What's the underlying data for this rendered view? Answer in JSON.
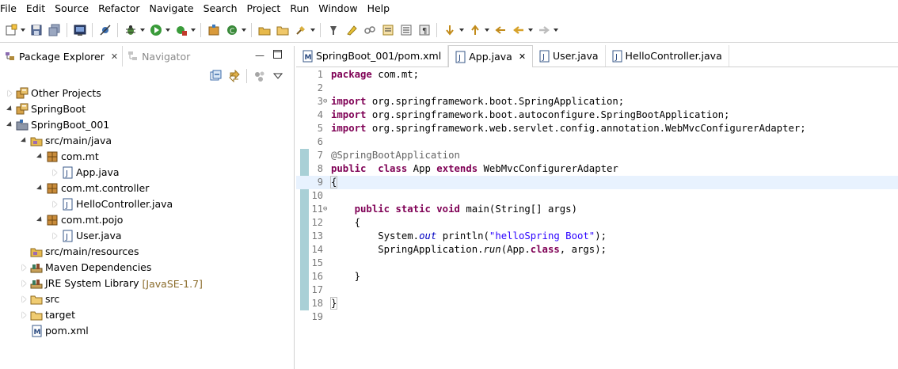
{
  "menu": [
    "File",
    "Edit",
    "Source",
    "Refactor",
    "Navigate",
    "Search",
    "Project",
    "Run",
    "Window",
    "Help"
  ],
  "left_tabs": {
    "package_explorer": "Package Explorer",
    "navigator": "Navigator"
  },
  "tree": [
    {
      "label": "Other Projects",
      "icon": "working-set-icon",
      "twisty": "closed",
      "depth": 0
    },
    {
      "label": "SpringBoot",
      "icon": "working-set-icon",
      "twisty": "open",
      "depth": 0
    },
    {
      "label": "SpringBoot_001",
      "icon": "project-icon",
      "twisty": "open",
      "depth": 1
    },
    {
      "label": "src/main/java",
      "icon": "source-folder-icon",
      "twisty": "open",
      "depth": 2
    },
    {
      "label": "com.mt",
      "icon": "package-icon",
      "twisty": "open",
      "depth": 3
    },
    {
      "label": "App.java",
      "icon": "java-file-icon",
      "twisty": "closed",
      "depth": 4
    },
    {
      "label": "com.mt.controller",
      "icon": "package-icon",
      "twisty": "open",
      "depth": 3
    },
    {
      "label": "HelloController.java",
      "icon": "java-file-icon",
      "twisty": "closed",
      "depth": 4
    },
    {
      "label": "com.mt.pojo",
      "icon": "package-icon",
      "twisty": "open",
      "depth": 3
    },
    {
      "label": "User.java",
      "icon": "java-file-icon",
      "twisty": "closed",
      "depth": 4
    },
    {
      "label": "src/main/resources",
      "icon": "source-folder-icon",
      "twisty": "none",
      "depth": 2
    },
    {
      "label": "Maven Dependencies",
      "icon": "library-icon",
      "twisty": "closed",
      "depth": 2
    },
    {
      "label": "JRE System Library",
      "icon": "library-icon",
      "twisty": "closed",
      "depth": 2,
      "deco": "[JavaSE-1.7]"
    },
    {
      "label": "src",
      "icon": "folder-icon",
      "twisty": "closed",
      "depth": 2
    },
    {
      "label": "target",
      "icon": "folder-icon",
      "twisty": "closed",
      "depth": 2
    },
    {
      "label": "pom.xml",
      "icon": "xml-file-icon",
      "twisty": "none",
      "depth": 2
    }
  ],
  "editor_tabs": [
    {
      "label": "SpringBoot_001/pom.xml",
      "icon": "maven-file-icon",
      "active": false
    },
    {
      "label": "App.java",
      "icon": "java-file-icon",
      "active": true
    },
    {
      "label": "User.java",
      "icon": "java-file-icon",
      "active": false
    },
    {
      "label": "HelloController.java",
      "icon": "java-file-icon",
      "active": false
    }
  ],
  "code": [
    {
      "n": "1",
      "tokens": [
        [
          "kw",
          "package"
        ],
        [
          "",
          "com.mt;"
        ]
      ]
    },
    {
      "n": "2",
      "tokens": []
    },
    {
      "n": "3",
      "fold": "minus",
      "tokens": [
        [
          "kw",
          "import"
        ],
        [
          "",
          "org.springframework.boot.SpringApplication;"
        ]
      ]
    },
    {
      "n": "4",
      "tokens": [
        [
          "kw",
          "import"
        ],
        [
          "",
          "org.springframework.boot.autoconfigure.SpringBootApplication;"
        ]
      ]
    },
    {
      "n": "5",
      "tokens": [
        [
          "kw",
          "import"
        ],
        [
          "",
          "org.springframework.web.servlet.config.annotation.WebMvcConfigurerAdapter;"
        ]
      ]
    },
    {
      "n": "6",
      "tokens": []
    },
    {
      "n": "7",
      "tokens": [
        [
          "ann",
          "@SpringBootApplication"
        ]
      ]
    },
    {
      "n": "8",
      "tokens": [
        [
          "kw",
          "public"
        ],
        [
          "",
          ""
        ],
        [
          "kw",
          "class"
        ],
        [
          "",
          "App"
        ],
        [
          "kw",
          "extends"
        ],
        [
          "",
          "WebMvcConfigurerAdapter"
        ]
      ]
    },
    {
      "n": "9",
      "cur": true,
      "tokens": [
        [
          "brace",
          "{"
        ]
      ]
    },
    {
      "n": "10",
      "tokens": []
    },
    {
      "n": "11",
      "fold": "minus",
      "tokens": [
        [
          "sp",
          "    "
        ],
        [
          "kw",
          "public"
        ],
        [
          "kw",
          "static"
        ],
        [
          "kw",
          "void"
        ],
        [
          "",
          "main(String[] args)"
        ]
      ]
    },
    {
      "n": "12",
      "tokens": [
        [
          "sp",
          "    "
        ],
        [
          "",
          "{"
        ]
      ]
    },
    {
      "n": "13",
      "tokens": [
        [
          "sp",
          "        "
        ],
        [
          "",
          "System."
        ],
        [
          "fld",
          "out"
        ],
        [
          "",
          "println("
        ],
        [
          "str",
          "\"helloSpring Boot\""
        ],
        [
          "",
          ");"
        ]
      ]
    },
    {
      "n": "14",
      "tokens": [
        [
          "sp",
          "        "
        ],
        [
          "",
          "SpringApplication."
        ],
        [
          "ital",
          "run"
        ],
        [
          "",
          "(App."
        ],
        [
          "kw",
          "class"
        ],
        [
          "",
          ", args);"
        ]
      ]
    },
    {
      "n": "15",
      "tokens": []
    },
    {
      "n": "16",
      "tokens": [
        [
          "sp",
          "    "
        ],
        [
          "",
          "}"
        ]
      ]
    },
    {
      "n": "17",
      "tokens": []
    },
    {
      "n": "18",
      "tokens": [
        [
          "brace",
          "}"
        ]
      ]
    },
    {
      "n": "19",
      "tokens": []
    }
  ]
}
